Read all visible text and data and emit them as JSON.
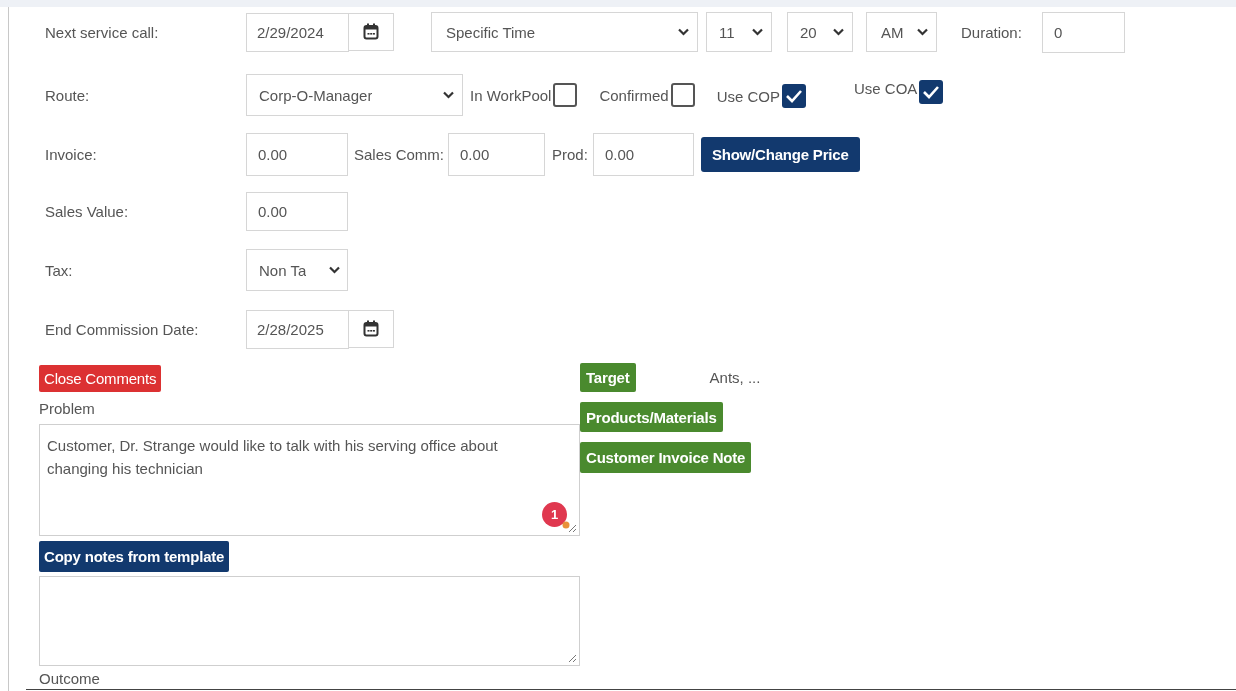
{
  "next_service_call": {
    "label": "Next service call:",
    "date": "2/29/2024",
    "time_mode": "Specific Time",
    "hour": "11",
    "minute": "20",
    "ampm": "AM",
    "duration_label": "Duration:",
    "duration": "0"
  },
  "route": {
    "label": "Route:",
    "value": "Corp-O-Manager",
    "checks": [
      {
        "label": "In WorkPool",
        "checked": false
      },
      {
        "label": "Confirmed",
        "checked": false
      },
      {
        "label": "Use COP",
        "checked": true
      },
      {
        "label": "Use COA",
        "checked": true
      }
    ]
  },
  "invoice": {
    "label": "Invoice:",
    "value": "0.00",
    "sales_comm_label": "Sales Comm:",
    "sales_comm": "0.00",
    "prod_label": "Prod:",
    "prod": "0.00",
    "button": "Show/Change Price"
  },
  "sales_value": {
    "label": "Sales Value:",
    "value": "0.00"
  },
  "tax": {
    "label": "Tax:",
    "value": "Non Ta"
  },
  "end_commission": {
    "label": "End Commission Date:",
    "date": "2/28/2025"
  },
  "close_comments_button": "Close Comments",
  "target": {
    "button": "Target",
    "value": "Ants, ..."
  },
  "side_buttons": [
    "Products/Materials",
    "Customer Invoice Note"
  ],
  "problem": {
    "label": "Problem",
    "text": "Customer, Dr. Strange would like to talk with his serving office about changing his technician",
    "badge": "1"
  },
  "copy_button": "Copy notes from template",
  "outcome_label": "Outcome"
}
